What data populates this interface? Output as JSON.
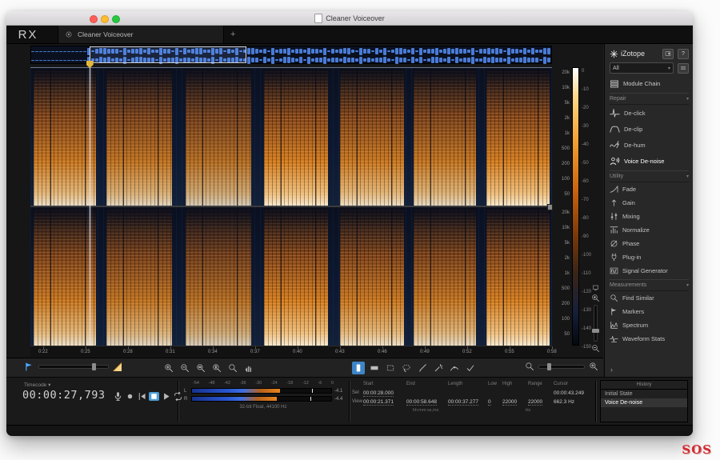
{
  "window": {
    "title": "Cleaner Voiceover",
    "controls": [
      "close",
      "minimize",
      "zoom"
    ],
    "traffic_colors": [
      "#ff5f57",
      "#febc2e",
      "#28c840"
    ]
  },
  "app": {
    "logo": "RX",
    "tab_label": "Cleaner Voiceover",
    "new_tab_label": "+"
  },
  "sidebar": {
    "brand": "iZotope",
    "filter_value": "All",
    "filter_caret": "▾",
    "menu_button_icon": "menu-icon",
    "help_label": "?",
    "module_chain_label": "Module Chain",
    "collapse_chevron": "›",
    "sections": [
      {
        "label": "Repair",
        "items": [
          {
            "icon": "de-click",
            "label": "De-click"
          },
          {
            "icon": "de-clip",
            "label": "De-clip"
          },
          {
            "icon": "de-hum",
            "label": "De-hum"
          },
          {
            "icon": "voice-denoise",
            "label": "Voice De-noise",
            "selected": true
          }
        ]
      },
      {
        "label": "Utility",
        "items": [
          {
            "icon": "fade",
            "label": "Fade"
          },
          {
            "icon": "gain",
            "label": "Gain"
          },
          {
            "icon": "mixing",
            "label": "Mixing"
          },
          {
            "icon": "normalize",
            "label": "Normalize"
          },
          {
            "icon": "phase",
            "label": "Phase"
          },
          {
            "icon": "plug-in",
            "label": "Plug-in"
          },
          {
            "icon": "signal-generator",
            "label": "Signal Generator"
          }
        ]
      },
      {
        "label": "Measurements",
        "items": [
          {
            "icon": "find-similar",
            "label": "Find Similar"
          },
          {
            "icon": "markers",
            "label": "Markers"
          },
          {
            "icon": "spectrum",
            "label": "Spectrum"
          },
          {
            "icon": "waveform-stats",
            "label": "Waveform Stats"
          }
        ]
      }
    ]
  },
  "spectrogram": {
    "freq_labels": [
      "20k",
      "10k",
      "5k",
      "2k",
      "1k",
      "500",
      "200",
      "100",
      "50"
    ],
    "db_labels": [
      "0",
      "-10",
      "-20",
      "-30",
      "-40",
      "-50",
      "-60",
      "-70",
      "-80",
      "-90",
      "-100",
      "-110",
      "-120",
      "-130",
      "-140",
      "-150"
    ],
    "time_labels": [
      "0:22",
      "0:25",
      "0:28",
      "0:31",
      "0:34",
      "0:37",
      "0:40",
      "0:43",
      "0:46",
      "0:49",
      "0:52",
      "0:55",
      "0:58"
    ],
    "bursts": [
      {
        "x": 0.6,
        "w": 12.0,
        "i": 0.95
      },
      {
        "x": 14.6,
        "w": 12.6,
        "i": 0.9
      },
      {
        "x": 29.8,
        "w": 12.6,
        "i": 0.85
      },
      {
        "x": 44.8,
        "w": 12.2,
        "i": 1.0
      },
      {
        "x": 59.4,
        "w": 12.2,
        "i": 0.95
      },
      {
        "x": 73.4,
        "w": 12.0,
        "i": 0.92
      },
      {
        "x": 87.4,
        "w": 12.2,
        "i": 1.0
      }
    ],
    "playhead_pct": 11.3,
    "view_selection": {
      "start_pct": 11.3,
      "width_pct": 30.1
    },
    "marker_color": "#e3b73a",
    "hot_color": "#e8851e"
  },
  "toolbar": {
    "zoom_tools": [
      "zoom-in",
      "zoom-out",
      "zoom-time",
      "zoom-freq",
      "zoom-all",
      "hand"
    ],
    "selection_tools": [
      {
        "name": "time-selection",
        "icon": "sel-time",
        "active": true
      },
      {
        "name": "frequency-selection",
        "icon": "sel-freq"
      },
      {
        "name": "time-frequency-selection",
        "icon": "sel-timefreq"
      },
      {
        "name": "lasso",
        "icon": "lasso"
      },
      {
        "name": "brush",
        "icon": "brush"
      },
      {
        "name": "wand",
        "icon": "wand"
      },
      {
        "name": "smart-pick",
        "icon": "pick"
      },
      {
        "name": "commit",
        "icon": "check"
      }
    ],
    "accent": "#4da6ff"
  },
  "transport": {
    "time_format_label": "Timecode",
    "time_format_caret": "▾",
    "time": "00:00:27,793",
    "buttons": [
      {
        "name": "record-mic",
        "icon": "mic"
      },
      {
        "name": "record",
        "icon": "record-dot"
      },
      {
        "name": "go-to-start",
        "icon": "to-start"
      },
      {
        "name": "stop",
        "icon": "stop",
        "active": true
      },
      {
        "name": "play",
        "icon": "play"
      },
      {
        "name": "loop",
        "icon": "loop"
      }
    ]
  },
  "meters": {
    "scale": [
      "-54",
      "-48",
      "-42",
      "-36",
      "-30",
      "-24",
      "-18",
      "-12",
      "-6",
      "0"
    ],
    "left_label": "L",
    "right_label": "R",
    "left_fill_pct": 63,
    "right_fill_pct": 61,
    "left_peak_pct": 86,
    "right_peak_pct": 85,
    "left_peak": "-4.1",
    "right_peak": "-4.4",
    "format": "32-bit Float, 44100 Hz"
  },
  "selection_info": {
    "headers": [
      "",
      "Start",
      "End",
      "Length",
      "Low",
      "High",
      "Range",
      "Cursor"
    ],
    "rows": [
      {
        "label": "Sel",
        "start": "00:00:28.000",
        "end": "",
        "length": "",
        "low": "",
        "high": "",
        "range": "",
        "cursor": "00:00:43.249"
      },
      {
        "label": "View",
        "start": "00:00:21.371",
        "end": "00:00:58.648",
        "length": "00:00:37.277",
        "low": "0",
        "high": "22000",
        "range": "22000",
        "cursor": "662.3 Hz"
      }
    ],
    "units_time": "hh:mm:ss,ms",
    "units_freq": "Hz"
  },
  "history": {
    "title": "History",
    "items": [
      {
        "label": "Initial State"
      },
      {
        "label": "Voice De-noise",
        "selected": true
      }
    ]
  },
  "watermark": "SOS"
}
